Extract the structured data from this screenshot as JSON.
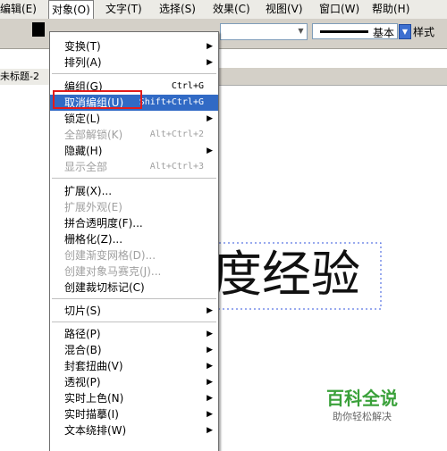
{
  "menubar": {
    "items": [
      {
        "label": "编辑(E)"
      },
      {
        "label": "对象(O)"
      },
      {
        "label": "文字(T)"
      },
      {
        "label": "选择(S)"
      },
      {
        "label": "效果(C)"
      },
      {
        "label": "视图(V)"
      },
      {
        "label": "窗口(W)"
      },
      {
        "label": "帮助(H)"
      }
    ]
  },
  "control_bar": {
    "stroke_profile": "基本",
    "style_label": "样式"
  },
  "document": {
    "tab_title": "未标题-2"
  },
  "canvas": {
    "text": "度经验"
  },
  "watermark": {
    "title": "百科全说",
    "subtitle": "助你轻松解决"
  },
  "object_menu": {
    "items": [
      {
        "label": "变换(T)",
        "shortcut": "",
        "submenu": true,
        "disabled": false
      },
      {
        "label": "排列(A)",
        "shortcut": "",
        "submenu": true,
        "disabled": false
      },
      {
        "label": "编组(G)",
        "shortcut": "Ctrl+G",
        "submenu": false,
        "disabled": false
      },
      {
        "label": "取消编组(U)",
        "shortcut": "Shift+Ctrl+G",
        "submenu": false,
        "disabled": false
      },
      {
        "label": "锁定(L)",
        "shortcut": "",
        "submenu": true,
        "disabled": false
      },
      {
        "label": "全部解锁(K)",
        "shortcut": "Alt+Ctrl+2",
        "submenu": false,
        "disabled": true
      },
      {
        "label": "隐藏(H)",
        "shortcut": "",
        "submenu": true,
        "disabled": false
      },
      {
        "label": "显示全部",
        "shortcut": "Alt+Ctrl+3",
        "submenu": false,
        "disabled": true
      },
      {
        "label": "扩展(X)...",
        "shortcut": "",
        "submenu": false,
        "disabled": false
      },
      {
        "label": "扩展外观(E)",
        "shortcut": "",
        "submenu": false,
        "disabled": true
      },
      {
        "label": "拼合透明度(F)...",
        "shortcut": "",
        "submenu": false,
        "disabled": false
      },
      {
        "label": "栅格化(Z)...",
        "shortcut": "",
        "submenu": false,
        "disabled": false
      },
      {
        "label": "创建渐变网格(D)...",
        "shortcut": "",
        "submenu": false,
        "disabled": true
      },
      {
        "label": "创建对象马赛克(J)...",
        "shortcut": "",
        "submenu": false,
        "disabled": true
      },
      {
        "label": "创建裁切标记(C)",
        "shortcut": "",
        "submenu": false,
        "disabled": false
      },
      {
        "label": "切片(S)",
        "shortcut": "",
        "submenu": true,
        "disabled": false
      },
      {
        "label": "路径(P)",
        "shortcut": "",
        "submenu": true,
        "disabled": false
      },
      {
        "label": "混合(B)",
        "shortcut": "",
        "submenu": true,
        "disabled": false
      },
      {
        "label": "封套扭曲(V)",
        "shortcut": "",
        "submenu": true,
        "disabled": false
      },
      {
        "label": "透视(P)",
        "shortcut": "",
        "submenu": true,
        "disabled": false
      },
      {
        "label": "实时上色(N)",
        "shortcut": "",
        "submenu": true,
        "disabled": false
      },
      {
        "label": "实时描摹(I)",
        "shortcut": "",
        "submenu": true,
        "disabled": false
      },
      {
        "label": "文本绕排(W)",
        "shortcut": "",
        "submenu": true,
        "disabled": false
      }
    ],
    "highlighted_index": 3
  },
  "colors": {
    "menu_highlight": "#316ac5",
    "annotation_box": "#e21b1b",
    "watermark_green": "#3aa13a",
    "selection_blue": "#3355dd"
  },
  "icons": {
    "submenu": "triangle-right",
    "workspace": "layout-grid",
    "dropdown": "triangle-down"
  }
}
